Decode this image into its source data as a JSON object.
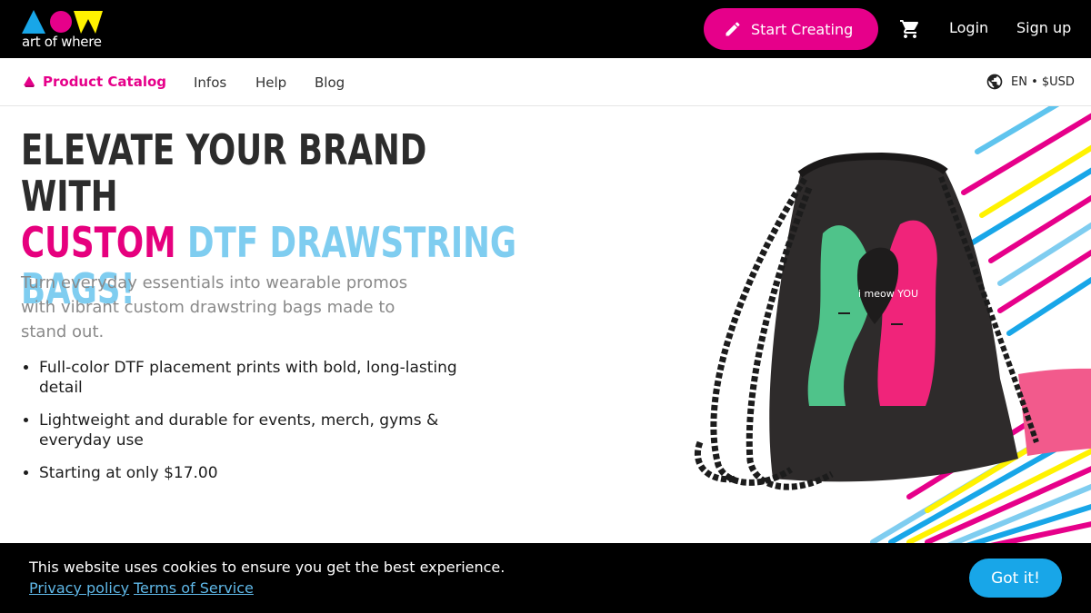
{
  "brand": {
    "logo_text": "art of where",
    "colors": {
      "cyan": "#18a6e8",
      "magenta": "#e6008a",
      "yellow": "#fff200",
      "black": "#000000"
    }
  },
  "header": {
    "start_creating": "Start Creating",
    "cart_icon": "shopping-cart-icon",
    "login": "Login",
    "signup": "Sign up"
  },
  "subnav": {
    "catalog": "Product Catalog",
    "links": [
      "Infos",
      "Help",
      "Blog"
    ],
    "locale": "EN • $USD"
  },
  "hero": {
    "title_line1": "Elevate your brand with",
    "title_custom": "Custom",
    "title_rest": "DTF Drawstring",
    "title_line3": "Bags!",
    "subtitle": "Turn everyday essentials into wearable promos with vibrant custom drawstring bags made to stand out.",
    "bullets": [
      "Full-color DTF placement prints with bold, long-lasting detail",
      "Lightweight and durable for events, merch, gyms & everyday use",
      "Starting at only $17.00"
    ],
    "bag_print_text": "i meow YOU"
  },
  "cookie": {
    "message": "This website uses cookies to ensure you get the best experience.",
    "privacy": "Privacy policy",
    "terms": "Terms of Service",
    "accept": "Got it!"
  }
}
